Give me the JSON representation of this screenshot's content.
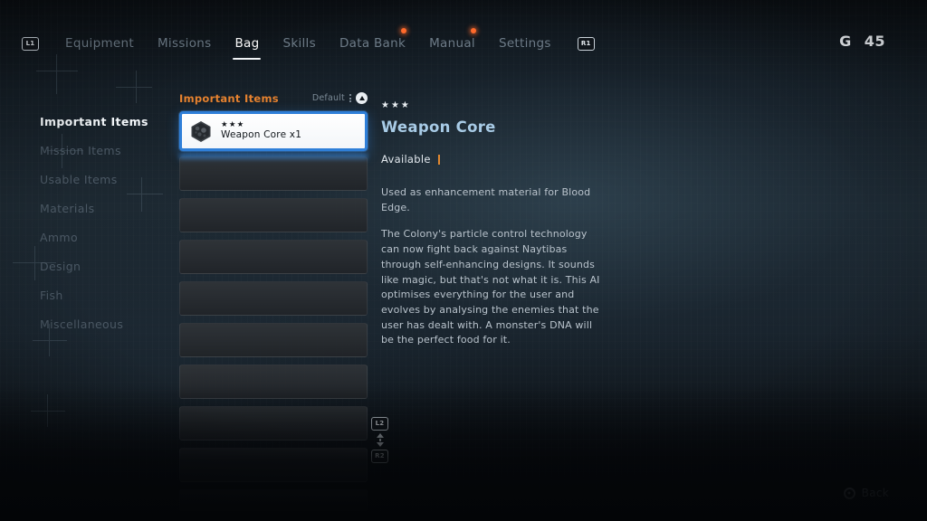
{
  "topbar": {
    "left_bumper": "L1",
    "right_bumper": "R1",
    "tabs": [
      {
        "label": "Equipment",
        "active": false,
        "notify": false
      },
      {
        "label": "Missions",
        "active": false,
        "notify": false
      },
      {
        "label": "Bag",
        "active": true,
        "notify": false
      },
      {
        "label": "Skills",
        "active": false,
        "notify": false
      },
      {
        "label": "Data Bank",
        "active": false,
        "notify": true
      },
      {
        "label": "Manual",
        "active": false,
        "notify": true
      },
      {
        "label": "Settings",
        "active": false,
        "notify": false
      }
    ],
    "currency": {
      "symbol": "G",
      "amount": "45"
    }
  },
  "sidebar": {
    "items": [
      {
        "label": "Important Items",
        "active": true
      },
      {
        "label": "Mission Items",
        "active": false
      },
      {
        "label": "Usable Items",
        "active": false
      },
      {
        "label": "Materials",
        "active": false
      },
      {
        "label": "Ammo",
        "active": false
      },
      {
        "label": "Design",
        "active": false
      },
      {
        "label": "Fish",
        "active": false
      },
      {
        "label": "Miscellaneous",
        "active": false
      }
    ]
  },
  "item_list": {
    "title": "Important Items",
    "sort_label": "Default",
    "sort_button": "triangle",
    "selected_item": {
      "stars": "★★★",
      "name": "Weapon Core x1",
      "icon": "weapon-core-icon"
    },
    "empty_row_count": 9,
    "scroll_prompt": {
      "up_button": "L2",
      "down_button": "R2"
    }
  },
  "detail": {
    "stars": "★★★",
    "title": "Weapon Core",
    "status": "Available",
    "description_1": "Used as enhancement material for Blood Edge.",
    "description_2": "The Colony's particle control technology can now fight back against Naytibas through self-enhancing designs. It sounds like magic, but that's not what it is. This AI optimises everything for the user and evolves by analysing the enemies that the user has dealt with. A monster's DNA will be the perfect food for it."
  },
  "footer": {
    "back_label": "Back",
    "back_button_icon": "circle-button-icon"
  }
}
